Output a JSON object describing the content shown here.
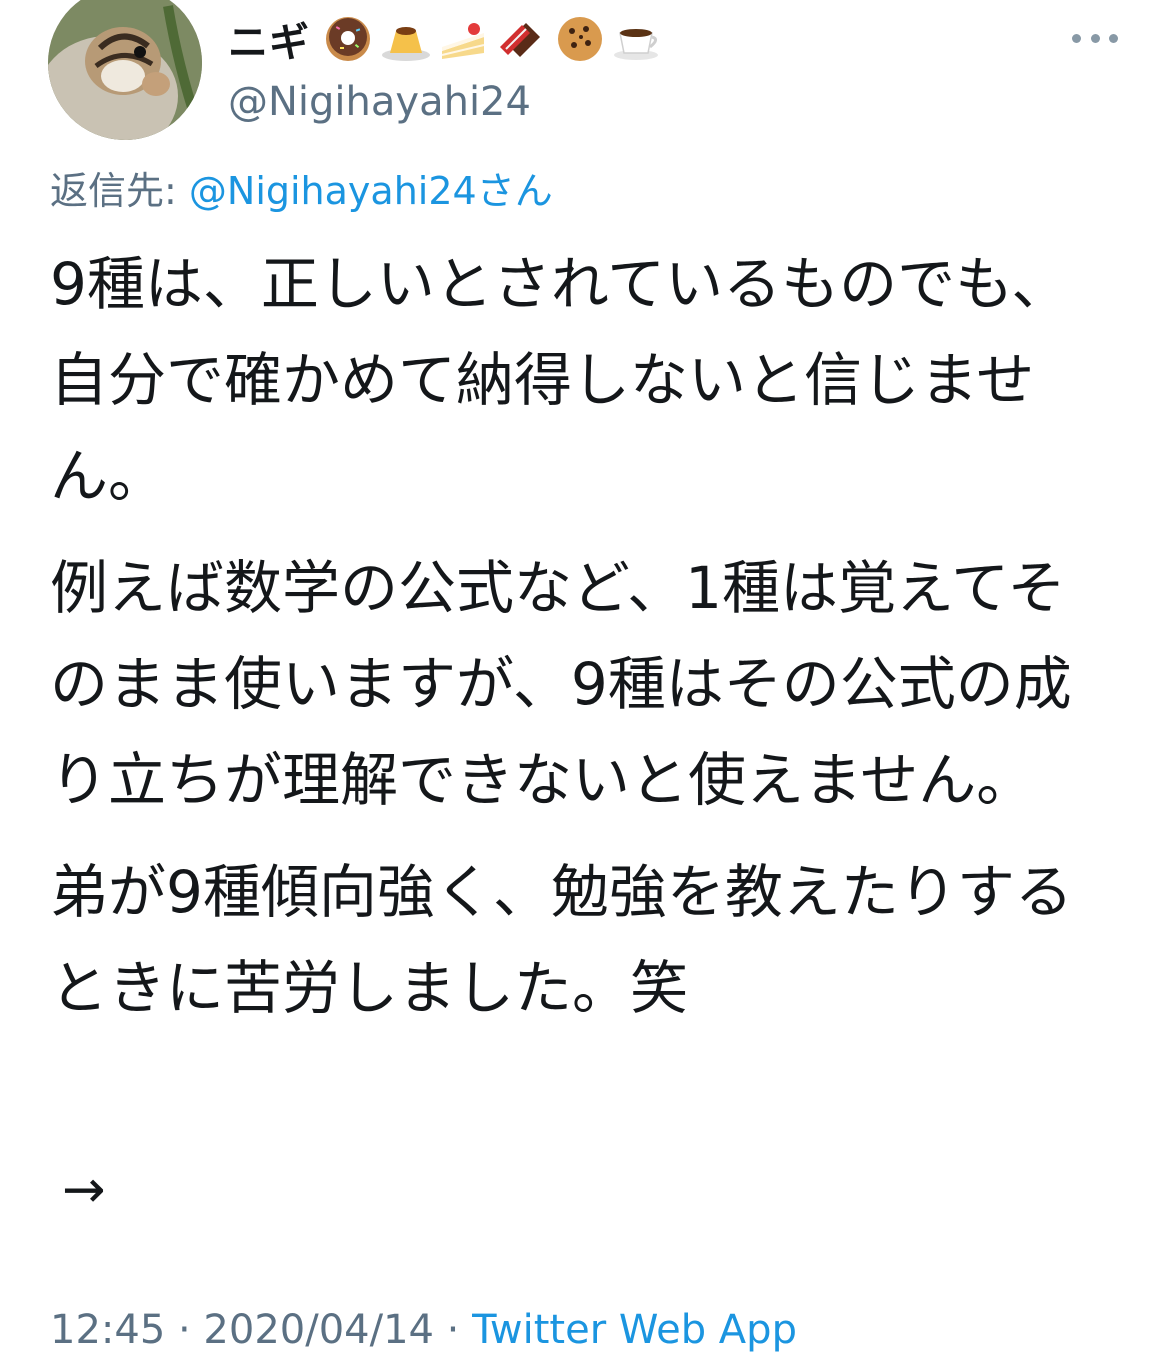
{
  "user": {
    "display_name": "ニギ",
    "handle": "@Nigihayahi24",
    "emoji_icons": [
      "donut-icon",
      "pudding-icon",
      "cake-icon",
      "chocolate-icon",
      "cookie-icon",
      "coffee-icon"
    ]
  },
  "reply": {
    "prefix": "返信先: ",
    "mention": "@Nigihayahi24",
    "suffix": "さん"
  },
  "paragraphs": [
    "9種は、正しいとされているものでも、自分で確かめて納得しないと信じません。",
    "例えば数学の公式など、1種は覚えてそのまま使いますが、9種はその公式の成り立ちが理解できないと使えません。",
    "弟が9種傾向強く、勉強を教えたりするときに苦労しました。笑"
  ],
  "arrow": "→",
  "footer": {
    "timestamp": "12:45 · 2020/04/14 · ",
    "source": "Twitter Web App"
  },
  "colors": {
    "link": "#1b95e0",
    "secondary_text": "#5b7083",
    "primary_text": "#14171a"
  }
}
